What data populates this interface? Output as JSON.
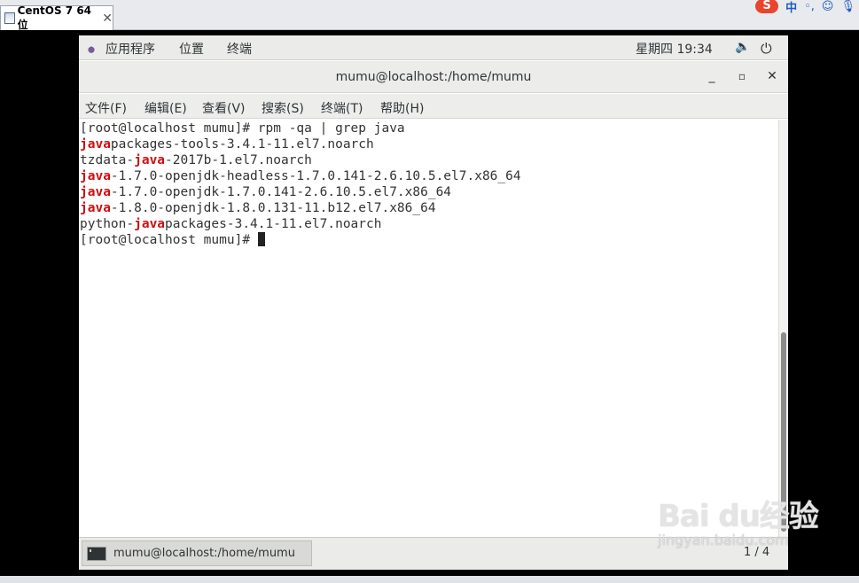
{
  "vm_tab": {
    "title": "CentOS 7 64 位",
    "close": "✕"
  },
  "ime": {
    "logo": "S",
    "mode": "中"
  },
  "topbar": {
    "apps": "应用程序",
    "places": "位置",
    "terminal": "终端",
    "clock": "星期四 19:34"
  },
  "window": {
    "title": "mumu@localhost:/home/mumu",
    "minimize": "_",
    "maximize": "▫",
    "close": "✕"
  },
  "menu": [
    "文件(F)",
    "编辑(E)",
    "查看(V)",
    "搜索(S)",
    "终端(T)",
    "帮助(H)"
  ],
  "terminal": {
    "lines": [
      {
        "pre": "[root@localhost mumu]# rpm -qa | grep java",
        "hl": "",
        "post": ""
      },
      {
        "pre": "",
        "hl": "java",
        "post": "packages-tools-3.4.1-11.el7.noarch"
      },
      {
        "pre": "tzdata-",
        "hl": "java",
        "post": "-2017b-1.el7.noarch"
      },
      {
        "pre": "",
        "hl": "java",
        "post": "-1.7.0-openjdk-headless-1.7.0.141-2.6.10.5.el7.x86_64"
      },
      {
        "pre": "",
        "hl": "java",
        "post": "-1.7.0-openjdk-1.7.0.141-2.6.10.5.el7.x86_64"
      },
      {
        "pre": "",
        "hl": "java",
        "post": "-1.8.0-openjdk-1.8.0.131-11.b12.el7.x86_64"
      },
      {
        "pre": "python-",
        "hl": "java",
        "post": "packages-3.4.1-11.el7.noarch"
      }
    ],
    "prompt": "[root@localhost mumu]# "
  },
  "taskbar": {
    "task": "mumu@localhost:/home/mumu",
    "workspace": "1 / 4"
  },
  "watermark": {
    "brand": "Bai du经验",
    "url": "jingyan.baidu.com"
  },
  "colors": {
    "highlight": "#cc1111"
  }
}
